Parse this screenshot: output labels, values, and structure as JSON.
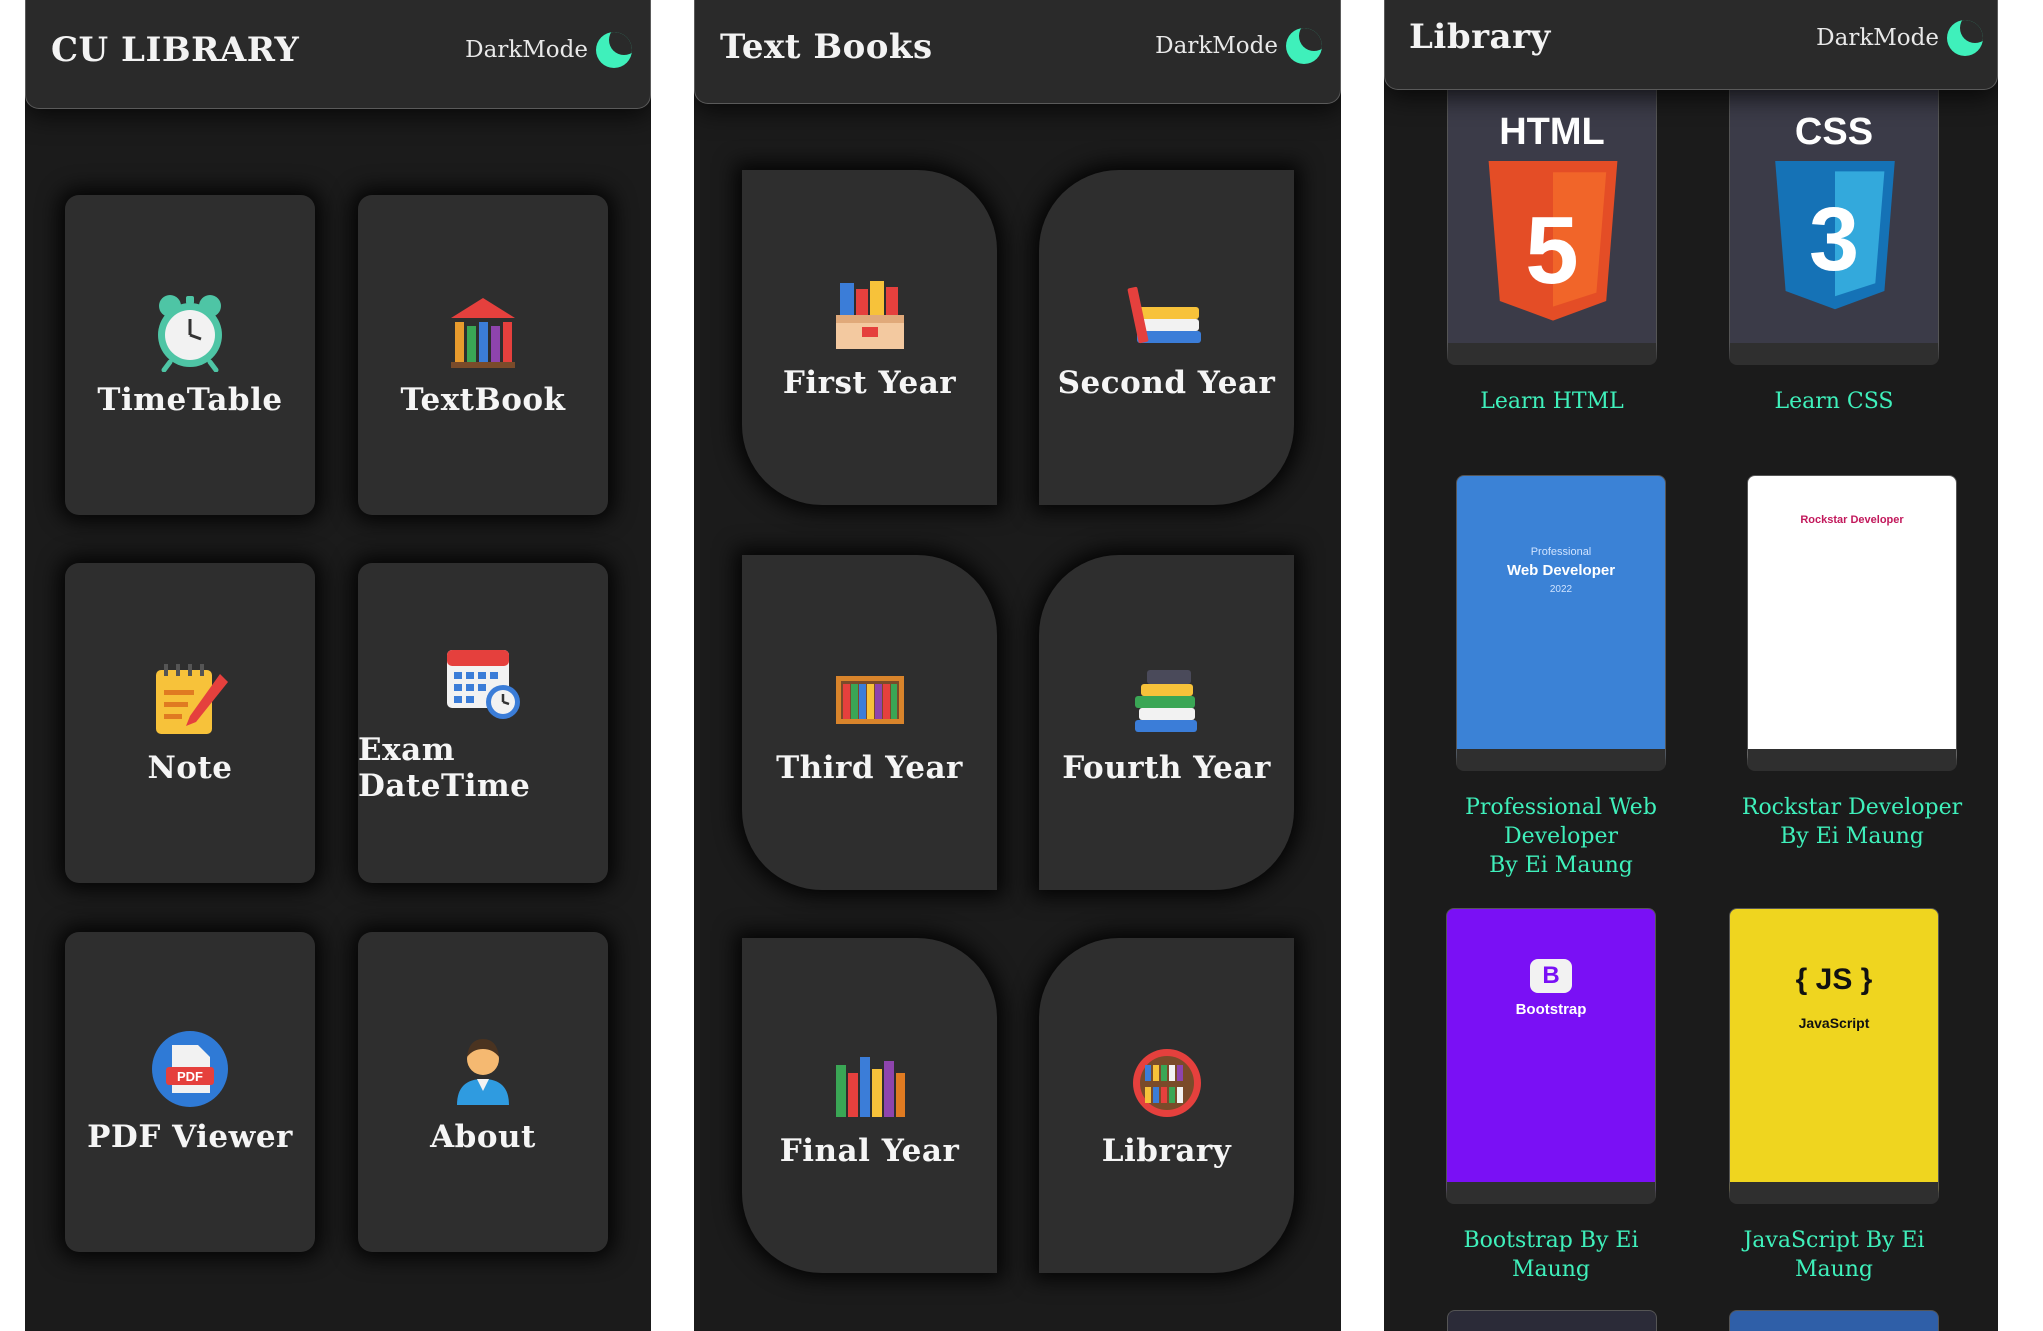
{
  "screen1": {
    "title": "CU LIBRARY",
    "dark_mode_label": "DarkMode",
    "tiles": [
      {
        "label": "TimeTable",
        "icon": "alarm-clock-icon"
      },
      {
        "label": "TextBook",
        "icon": "library-books-icon"
      },
      {
        "label": "Note",
        "icon": "notepad-pencil-icon"
      },
      {
        "label": "Exam DateTime",
        "icon": "calendar-clock-icon"
      },
      {
        "label": "PDF Viewer",
        "icon": "pdf-file-icon"
      },
      {
        "label": "About",
        "icon": "person-icon"
      }
    ]
  },
  "screen2": {
    "title": "Text Books",
    "dark_mode_label": "DarkMode",
    "tiles": [
      {
        "label": "First Year",
        "icon": "book-box-icon"
      },
      {
        "label": "Second Year",
        "icon": "book-stack-icon"
      },
      {
        "label": "Third Year",
        "icon": "bookshelf-icon"
      },
      {
        "label": "Fourth Year",
        "icon": "books-pile-icon"
      },
      {
        "label": "Final Year",
        "icon": "books-row-icon"
      },
      {
        "label": "Library",
        "icon": "round-bookshelf-icon"
      }
    ]
  },
  "screen3": {
    "title": "Library",
    "dark_mode_label": "DarkMode",
    "books": [
      {
        "caption": "Learn HTML",
        "cover_text": "HTML",
        "badge": "5",
        "color": "#e44d26"
      },
      {
        "caption": "Learn CSS",
        "cover_text": "CSS",
        "badge": "3",
        "color": "#1572b6"
      },
      {
        "caption_line1": "Professional Web Developer",
        "caption_line2": "By Ei Maung",
        "cover_kicker": "Professional",
        "cover_title": "Web Developer",
        "cover_year": "2022",
        "color": "#3b82d6"
      },
      {
        "caption_line1": "Rockstar Developer",
        "caption_line2": "By Ei Maung",
        "cover_title": "Rockstar Developer",
        "color": "#ffffff"
      },
      {
        "caption": "Bootstrap By Ei Maung",
        "cover_logo": "B",
        "cover_title": "Bootstrap",
        "color": "#7a10f5"
      },
      {
        "caption": "JavaScript By Ei Maung",
        "cover_logo": "{ JS }",
        "cover_title": "JavaScript",
        "color": "#efd51f"
      }
    ]
  },
  "colors": {
    "accent": "#3ff0bb",
    "background": "#1b1b1b",
    "card": "#2e2e2e"
  }
}
